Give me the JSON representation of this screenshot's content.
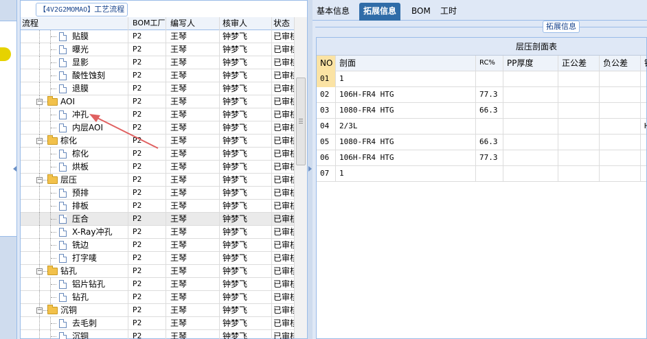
{
  "left_panel": {
    "title_prefix": "【4V2G2MOMAO】",
    "title_text": "工艺流程",
    "columns": [
      "流程",
      "BOM工厂",
      "编写人",
      "核审人",
      "状态"
    ],
    "rows": [
      {
        "type": "doc",
        "name": "贴膜",
        "bom": "P2",
        "writer": "王琴",
        "reviewer": "钟梦飞",
        "status": "已审核"
      },
      {
        "type": "doc",
        "name": "曝光",
        "bom": "P2",
        "writer": "王琴",
        "reviewer": "钟梦飞",
        "status": "已审核"
      },
      {
        "type": "doc",
        "name": "显影",
        "bom": "P2",
        "writer": "王琴",
        "reviewer": "钟梦飞",
        "status": "已审核"
      },
      {
        "type": "doc",
        "name": "酸性蚀刻",
        "bom": "P2",
        "writer": "王琴",
        "reviewer": "钟梦飞",
        "status": "已审核"
      },
      {
        "type": "doc",
        "name": "退膜",
        "bom": "P2",
        "writer": "王琴",
        "reviewer": "钟梦飞",
        "status": "已审核"
      },
      {
        "type": "folder",
        "name": "AOI",
        "bom": "P2",
        "writer": "王琴",
        "reviewer": "钟梦飞",
        "status": "已审核"
      },
      {
        "type": "doc",
        "name": "冲孔",
        "bom": "P2",
        "writer": "王琴",
        "reviewer": "钟梦飞",
        "status": "已审核"
      },
      {
        "type": "doc",
        "name": "内层AOI",
        "bom": "P2",
        "writer": "王琴",
        "reviewer": "钟梦飞",
        "status": "已审核"
      },
      {
        "type": "folder",
        "name": "棕化",
        "bom": "P2",
        "writer": "王琴",
        "reviewer": "钟梦飞",
        "status": "已审核"
      },
      {
        "type": "doc",
        "name": "棕化",
        "bom": "P2",
        "writer": "王琴",
        "reviewer": "钟梦飞",
        "status": "已审核"
      },
      {
        "type": "doc",
        "name": "烘板",
        "bom": "P2",
        "writer": "王琴",
        "reviewer": "钟梦飞",
        "status": "已审核"
      },
      {
        "type": "folder",
        "name": "层压",
        "bom": "P2",
        "writer": "王琴",
        "reviewer": "钟梦飞",
        "status": "已审核"
      },
      {
        "type": "doc",
        "name": "预排",
        "bom": "P2",
        "writer": "王琴",
        "reviewer": "钟梦飞",
        "status": "已审核"
      },
      {
        "type": "doc",
        "name": "排板",
        "bom": "P2",
        "writer": "王琴",
        "reviewer": "钟梦飞",
        "status": "已审核"
      },
      {
        "type": "doc",
        "name": "压合",
        "bom": "P2",
        "writer": "王琴",
        "reviewer": "钟梦飞",
        "status": "已审核",
        "selected": true
      },
      {
        "type": "doc",
        "name": "X-Ray冲孔",
        "bom": "P2",
        "writer": "王琴",
        "reviewer": "钟梦飞",
        "status": "已审核"
      },
      {
        "type": "doc",
        "name": "铣边",
        "bom": "P2",
        "writer": "王琴",
        "reviewer": "钟梦飞",
        "status": "已审核"
      },
      {
        "type": "doc",
        "name": "打字唛",
        "bom": "P2",
        "writer": "王琴",
        "reviewer": "钟梦飞",
        "status": "已审核"
      },
      {
        "type": "folder",
        "name": "钻孔",
        "bom": "P2",
        "writer": "王琴",
        "reviewer": "钟梦飞",
        "status": "已审核"
      },
      {
        "type": "doc",
        "name": "铝片钻孔",
        "bom": "P2",
        "writer": "王琴",
        "reviewer": "钟梦飞",
        "status": "已审核"
      },
      {
        "type": "doc",
        "name": "钻孔",
        "bom": "P2",
        "writer": "王琴",
        "reviewer": "钟梦飞",
        "status": "已审核"
      },
      {
        "type": "folder",
        "name": "沉铜",
        "bom": "P2",
        "writer": "王琴",
        "reviewer": "钟梦飞",
        "status": "已审核"
      },
      {
        "type": "doc",
        "name": "去毛刺",
        "bom": "P2",
        "writer": "王琴",
        "reviewer": "钟梦飞",
        "status": "已审核"
      },
      {
        "type": "doc",
        "name": "沉铜",
        "bom": "P2",
        "writer": "王琴",
        "reviewer": "钟梦飞",
        "status": "已审核"
      }
    ]
  },
  "right_panel": {
    "tabs": [
      {
        "label": "基本信息",
        "active": false
      },
      {
        "label": "拓展信息",
        "active": true
      },
      {
        "label": "BOM",
        "active": false
      },
      {
        "label": "工时",
        "active": false
      }
    ],
    "group_title": "拓展信息",
    "table_title": "层压剖面表",
    "columns": [
      "NO",
      "剖面",
      "RC%",
      "PP厚度",
      "正公差",
      "负公差",
      "镀"
    ],
    "rows": [
      {
        "no": "01",
        "profile": "1",
        "rc": "",
        "pp": "",
        "pos": "",
        "neg": "",
        "extra": ""
      },
      {
        "no": "02",
        "profile": "106H-FR4 HTG",
        "rc": "77.3",
        "pp": "",
        "pos": "",
        "neg": "",
        "extra": ""
      },
      {
        "no": "03",
        "profile": "1080-FR4 HTG",
        "rc": "66.3",
        "pp": "",
        "pos": "",
        "neg": "",
        "extra": ""
      },
      {
        "no": "04",
        "profile": "2/3L",
        "rc": "",
        "pp": "",
        "pos": "",
        "neg": "",
        "extra": "H"
      },
      {
        "no": "05",
        "profile": "1080-FR4 HTG",
        "rc": "66.3",
        "pp": "",
        "pos": "",
        "neg": "",
        "extra": ""
      },
      {
        "no": "06",
        "profile": "106H-FR4 HTG",
        "rc": "77.3",
        "pp": "",
        "pos": "",
        "neg": "",
        "extra": ""
      },
      {
        "no": "07",
        "profile": "1",
        "rc": "",
        "pp": "",
        "pos": "",
        "neg": "",
        "extra": ""
      }
    ]
  },
  "colors": {
    "panel_border": "#99bbe8",
    "tab_active": "#2f6ca8",
    "arrow": "#e06060",
    "highlight_cell": "#fbe3a4"
  }
}
